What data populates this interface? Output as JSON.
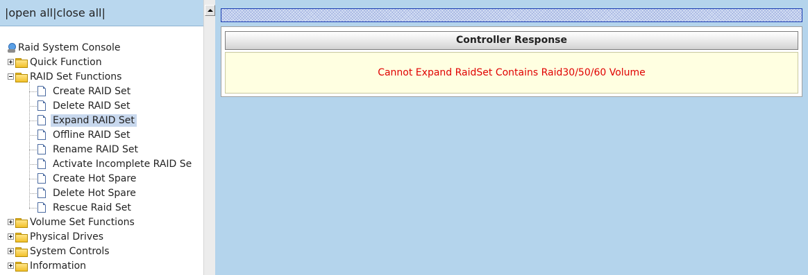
{
  "top_links": {
    "open_all": "open all",
    "close_all": "close all"
  },
  "tree": {
    "root": {
      "label": "Raid System Console",
      "icon": "console-icon"
    },
    "items": [
      {
        "label": "Quick Function",
        "type": "folder",
        "expanded": false
      },
      {
        "label": "RAID Set Functions",
        "type": "folder",
        "expanded": true,
        "children": [
          {
            "label": "Create RAID Set"
          },
          {
            "label": "Delete RAID Set"
          },
          {
            "label": "Expand RAID Set",
            "selected": true
          },
          {
            "label": "Offline RAID Set"
          },
          {
            "label": "Rename RAID Set"
          },
          {
            "label": "Activate Incomplete RAID Se"
          },
          {
            "label": "Create Hot Spare"
          },
          {
            "label": "Delete Hot Spare"
          },
          {
            "label": "Rescue Raid Set"
          }
        ]
      },
      {
        "label": "Volume Set Functions",
        "type": "folder",
        "expanded": false
      },
      {
        "label": "Physical Drives",
        "type": "folder",
        "expanded": false
      },
      {
        "label": "System Controls",
        "type": "folder",
        "expanded": false
      },
      {
        "label": "Information",
        "type": "folder",
        "expanded": false
      }
    ]
  },
  "response": {
    "header": "Controller Response",
    "message": "Cannot Expand RaidSet Contains Raid30/50/60 Volume"
  },
  "colors": {
    "page_background": "#b4d4ec",
    "message_text": "#e00000",
    "message_background": "#ffffe1",
    "selected_item": "#c8d8ee"
  }
}
